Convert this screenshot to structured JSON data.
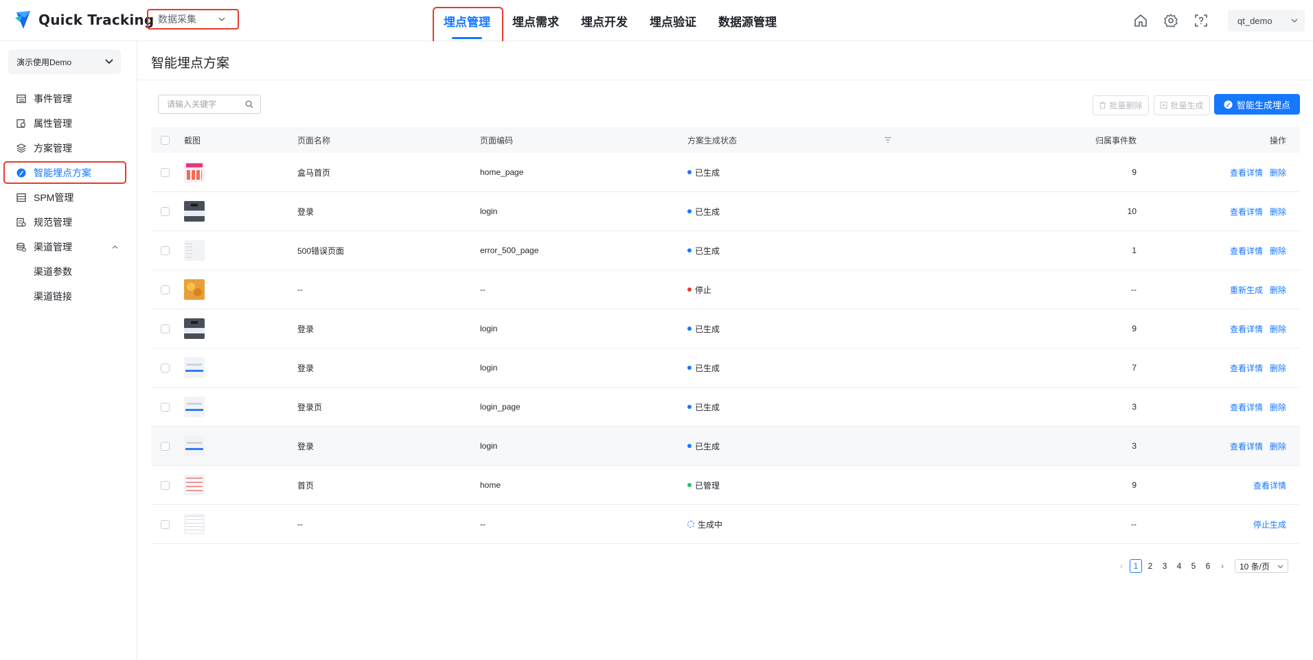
{
  "header": {
    "app_name": "Quick Tracking",
    "biz_select": "数据采集",
    "nav": [
      "埋点管理",
      "埋点需求",
      "埋点开发",
      "埋点验证",
      "数据源管理"
    ],
    "user": "qt_demo"
  },
  "sidebar": {
    "project": "演示使用Demo",
    "items": [
      {
        "label": "事件管理",
        "icon": "list-icon"
      },
      {
        "label": "属性管理",
        "icon": "property-icon"
      },
      {
        "label": "方案管理",
        "icon": "layers-icon"
      },
      {
        "label": "智能埋点方案",
        "icon": "smart-icon"
      },
      {
        "label": "SPM管理",
        "icon": "spm-icon"
      },
      {
        "label": "规范管理",
        "icon": "spec-icon"
      },
      {
        "label": "渠道管理",
        "icon": "channel-icon"
      }
    ],
    "sub_items": [
      "渠道参数",
      "渠道链接"
    ]
  },
  "main": {
    "title": "智能埋点方案",
    "search_placeholder": "请输入关键字",
    "batch_delete": "批量删除",
    "batch_generate": "批量生成",
    "smart_generate": "智能生成埋点"
  },
  "table": {
    "columns": [
      "截图",
      "页面名称",
      "页面编码",
      "方案生成状态",
      "归属事件数",
      "操作"
    ],
    "rows": [
      {
        "thumb": "red",
        "name": "盒马首页",
        "code": "home_page",
        "status": "已生成",
        "status_color": "#1677ff",
        "count": "9",
        "ops": [
          "查看详情",
          "删除"
        ]
      },
      {
        "thumb": "dark",
        "name": "登录",
        "code": "login",
        "status": "已生成",
        "status_color": "#1677ff",
        "count": "10",
        "ops": [
          "查看详情",
          "删除"
        ]
      },
      {
        "thumb": "faint",
        "name": "500错误页面",
        "code": "error_500_page",
        "status": "已生成",
        "status_color": "#1677ff",
        "count": "1",
        "ops": [
          "查看详情",
          "删除"
        ]
      },
      {
        "thumb": "orange",
        "name": "--",
        "code": "--",
        "status": "停止",
        "status_color": "#e53a2b",
        "count": "--",
        "ops": [
          "重新生成",
          "删除"
        ]
      },
      {
        "thumb": "dark",
        "name": "登录",
        "code": "login",
        "status": "已生成",
        "status_color": "#1677ff",
        "count": "9",
        "ops": [
          "查看详情",
          "删除"
        ]
      },
      {
        "thumb": "light",
        "name": "登录",
        "code": "login",
        "status": "已生成",
        "status_color": "#1677ff",
        "count": "7",
        "ops": [
          "查看详情",
          "删除"
        ]
      },
      {
        "thumb": "light",
        "name": "登录页",
        "code": "login_page",
        "status": "已生成",
        "status_color": "#1677ff",
        "count": "3",
        "ops": [
          "查看详情",
          "删除"
        ]
      },
      {
        "thumb": "light",
        "name": "登录",
        "code": "login",
        "status": "已生成",
        "status_color": "#1677ff",
        "count": "3",
        "ops": [
          "查看详情",
          "删除"
        ]
      },
      {
        "thumb": "pinklist",
        "name": "首页",
        "code": "home",
        "status": "已管理",
        "status_color": "#22c55e",
        "count": "9",
        "ops": [
          "查看详情"
        ]
      },
      {
        "thumb": "grid",
        "name": "--",
        "code": "--",
        "status": "生成中",
        "status_color": "spinner",
        "count": "--",
        "ops": [
          "停止生成"
        ]
      }
    ]
  },
  "pagination": {
    "pages": [
      "1",
      "2",
      "3",
      "4",
      "5",
      "6"
    ],
    "current": "1",
    "page_size": "10 条/页"
  }
}
